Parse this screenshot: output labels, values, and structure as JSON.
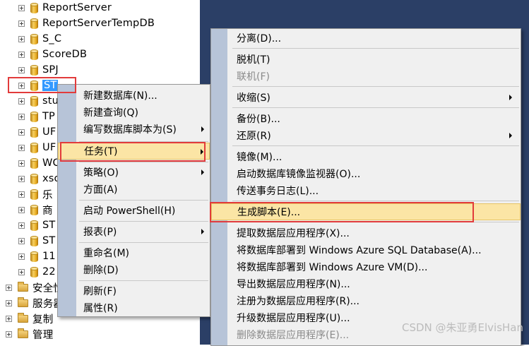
{
  "tree": {
    "items": [
      {
        "label": "ReportServer",
        "kind": "db"
      },
      {
        "label": "ReportServerTempDB",
        "kind": "db"
      },
      {
        "label": "S_C",
        "kind": "db"
      },
      {
        "label": "ScoreDB",
        "kind": "db"
      },
      {
        "label": "SPJ",
        "kind": "db"
      },
      {
        "label": "ST",
        "kind": "db",
        "selected": true
      },
      {
        "label": "stu",
        "kind": "db"
      },
      {
        "label": "TP",
        "kind": "db"
      },
      {
        "label": "UF",
        "kind": "db"
      },
      {
        "label": "UF",
        "kind": "db"
      },
      {
        "label": "WC",
        "kind": "db"
      },
      {
        "label": "xso",
        "kind": "db"
      },
      {
        "label": "乐",
        "kind": "db"
      },
      {
        "label": "商",
        "kind": "db"
      },
      {
        "label": "ST",
        "kind": "db"
      },
      {
        "label": "ST",
        "kind": "db"
      },
      {
        "label": "11",
        "kind": "db"
      },
      {
        "label": "22",
        "kind": "db"
      },
      {
        "label": "安全性",
        "kind": "folder"
      },
      {
        "label": "服务器",
        "kind": "folder"
      },
      {
        "label": "复制",
        "kind": "folder"
      },
      {
        "label": "管理",
        "kind": "folder"
      }
    ]
  },
  "context_menu": {
    "items": [
      {
        "label": "新建数据库(N)..."
      },
      {
        "label": "新建查询(Q)"
      },
      {
        "label": "编写数据库脚本为(S)",
        "submenu": true
      },
      {
        "label": "任务(T)",
        "submenu": true,
        "highlighted": true
      },
      {
        "label": "策略(O)",
        "submenu": true
      },
      {
        "label": "方面(A)"
      },
      {
        "label": "启动 PowerShell(H)"
      },
      {
        "label": "报表(P)",
        "submenu": true
      },
      {
        "label": "重命名(M)"
      },
      {
        "label": "删除(D)"
      },
      {
        "label": "刷新(F)"
      },
      {
        "label": "属性(R)"
      }
    ]
  },
  "tasks_menu": {
    "items": [
      {
        "label": "分离(D)..."
      },
      {
        "label": "脱机(T)"
      },
      {
        "label": "联机(F)",
        "disabled": true
      },
      {
        "label": "收缩(S)",
        "submenu": true
      },
      {
        "label": "备份(B)..."
      },
      {
        "label": "还原(R)",
        "submenu": true
      },
      {
        "label": "镜像(M)..."
      },
      {
        "label": "启动数据库镜像监视器(O)..."
      },
      {
        "label": "传送事务日志(L)..."
      },
      {
        "label": "生成脚本(E)...",
        "highlighted": true
      },
      {
        "label": "提取数据层应用程序(X)..."
      },
      {
        "label": "将数据库部署到 Windows Azure SQL Database(A)..."
      },
      {
        "label": "将数据库部署到 Windows Azure VM(D)..."
      },
      {
        "label": "导出数据层应用程序(N)..."
      },
      {
        "label": "注册为数据层应用程序(R)..."
      },
      {
        "label": "升级数据层应用程序(U)..."
      },
      {
        "label": "删除数据层应用程序(E)...",
        "disabled": true
      }
    ]
  },
  "watermark": "CSDN @朱亚勇ElvisHan",
  "colors": {
    "background_panel": "#2b3f66",
    "menu_bg": "#f0f0f0",
    "menu_gutter": "#b7c4d8",
    "highlight": "#fbe5a5",
    "annotation_red": "#e23b3b",
    "selection": "#3399ff"
  }
}
